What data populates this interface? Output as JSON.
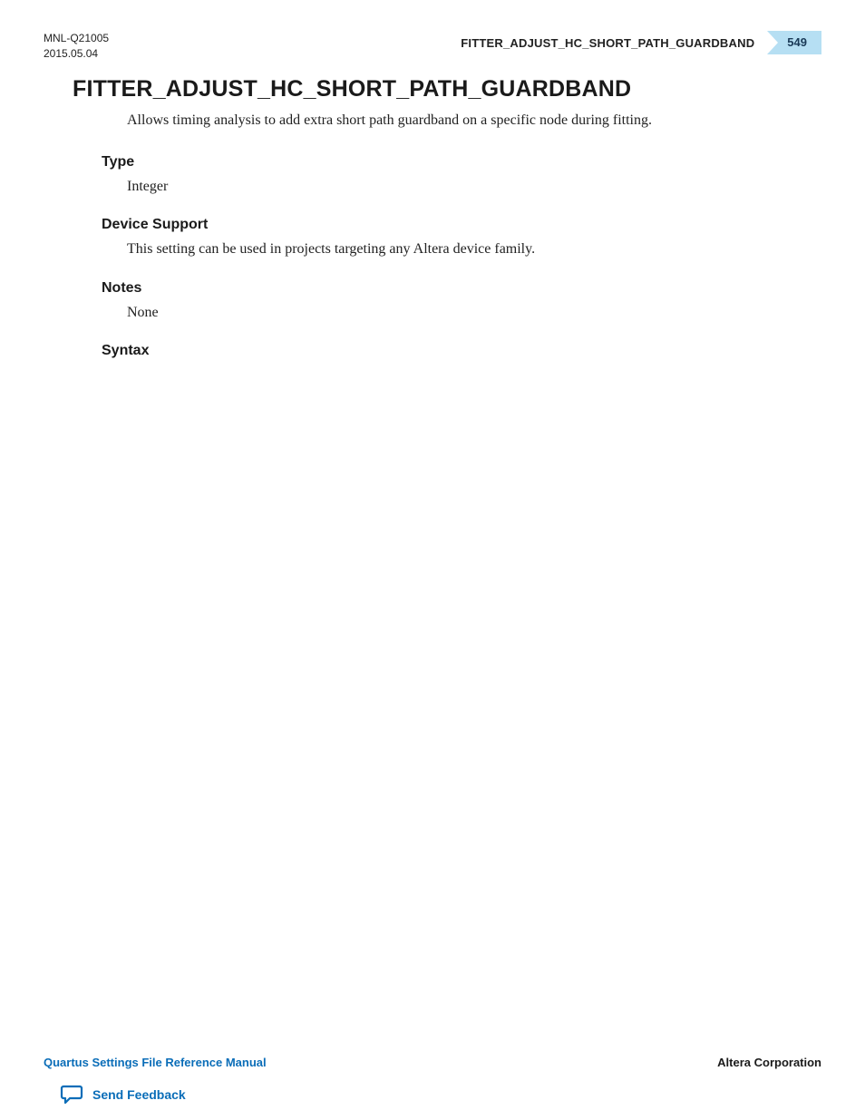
{
  "header": {
    "doc_id": "MNL-Q21005",
    "date": "2015.05.04",
    "running_title": "FITTER_ADJUST_HC_SHORT_PATH_GUARDBAND",
    "page_number": "549"
  },
  "title": "FITTER_ADJUST_HC_SHORT_PATH_GUARDBAND",
  "intro": "Allows timing analysis to add extra short path guardband on a specific node during fitting.",
  "sections": {
    "type": {
      "heading": "Type",
      "body": "Integer"
    },
    "device_support": {
      "heading": "Device Support",
      "body": "This setting can be used in projects targeting any Altera device family."
    },
    "notes": {
      "heading": "Notes",
      "body": "None"
    },
    "syntax": {
      "heading": "Syntax",
      "body": ""
    }
  },
  "footer": {
    "manual_name": "Quartus Settings File Reference Manual",
    "company": "Altera Corporation",
    "feedback_label": "Send Feedback"
  }
}
